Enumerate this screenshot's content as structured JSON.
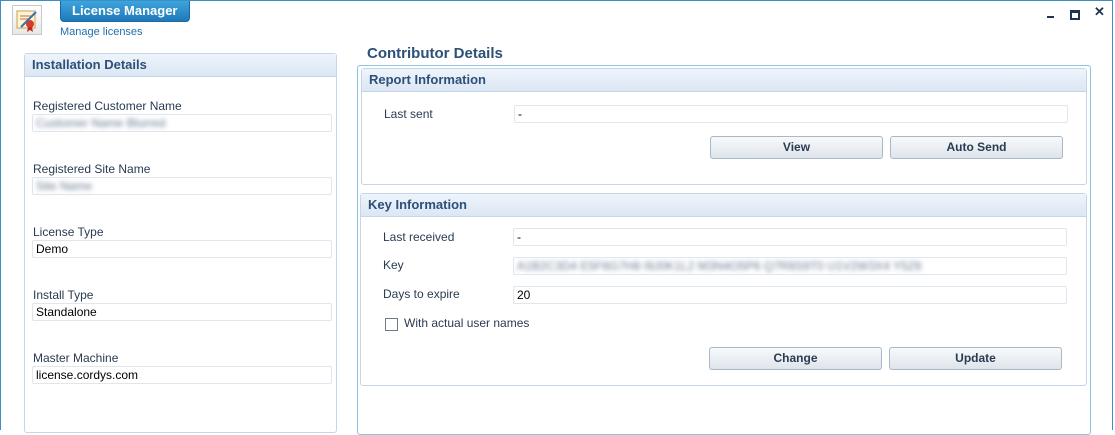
{
  "window": {
    "title": "License Manager",
    "subtitle": "Manage licenses",
    "minimize_icon": "minimize-icon",
    "restore_icon": "restore-icon",
    "close_icon": "close-icon"
  },
  "installation": {
    "heading": "Installation Details",
    "fields": [
      {
        "label": "Registered Customer Name",
        "value": "Customer Name Blurred",
        "blurred": true
      },
      {
        "label": "Registered Site Name",
        "value": "Site Name",
        "blurred": true
      },
      {
        "label": "License Type",
        "value": "Demo",
        "blurred": false
      },
      {
        "label": "Install Type",
        "value": "Standalone",
        "blurred": false
      },
      {
        "label": "Master Machine",
        "value": "license.cordys.com",
        "blurred": false
      }
    ]
  },
  "contributor": {
    "heading": "Contributor Details",
    "report": {
      "heading": "Report Information",
      "last_sent_label": "Last sent",
      "last_sent_value": "-",
      "view_button": "View",
      "auto_send_button": "Auto Send"
    },
    "key": {
      "heading": "Key Information",
      "last_received_label": "Last received",
      "last_received_value": "-",
      "key_label": "Key",
      "key_value": "A1B2C3D4 E5F6G7H8 I9J0K1L2 M3N4O5P6 Q7R8S9T0 U1V2W3X4 Y5Z6",
      "days_label": "Days to expire",
      "days_value": "20",
      "checkbox_label": "With actual user names",
      "checkbox_checked": false,
      "change_button": "Change",
      "update_button": "Update"
    }
  }
}
